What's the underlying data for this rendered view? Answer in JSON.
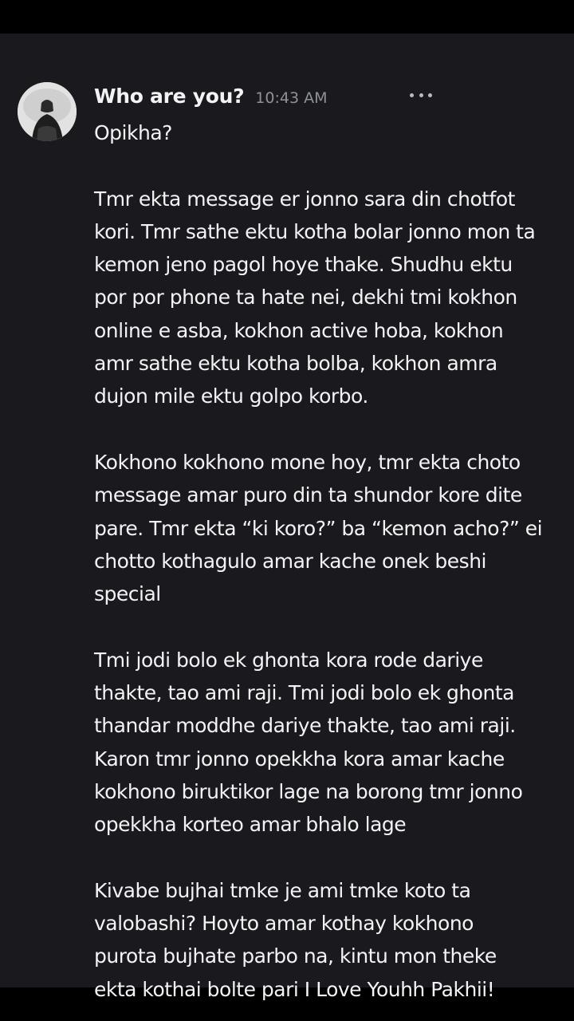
{
  "message": {
    "author": "Who are you?",
    "time": "10:43 AM",
    "greeting": "Opikha?",
    "paragraphs": [
      "Tmr ekta message er jonno sara din chotfot\nkori. Tmr sathe ektu kotha bolar jonno mon ta\nkemon jeno pagol hoye thake. Shudhu ektu\npor por phone ta hate nei, dekhi tmi kokhon\nonline e asba, kokhon active hoba, kokhon\namr sathe ektu kotha bolba, kokhon amra\ndujon mile ektu golpo korbo.",
      "Kokhono kokhono mone hoy, tmr ekta choto\nmessage amar puro din ta shundor kore dite\npare. Tmr ekta “ki koro?” ba “kemon acho?” ei\nchotto kothagulo amar kache onek beshi\nspecial",
      "Tmi jodi bolo ek ghonta kora rode dariye\nthakte, tao ami raji. Tmi jodi bolo ek ghonta\nthandar moddhe dariye thakte, tao ami raji.\nKaron tmr jonno opekkha kora amar kache\nkokhono biruktikor lage na borong tmr jonno\nopekkha korteo amar bhalo lage",
      "Kivabe bujhai tmke je ami tmke koto ta\nvalobashi? Hoyto amar kothay kokhono\npurota bujhate parbo na, kintu mon theke\nekta kothai bolte pari I Love Youhh Pakhii!"
    ]
  },
  "icons": {
    "avatar": "user-avatar-photo",
    "more": "more-options-icon"
  },
  "colors": {
    "background": "#1a1a1e",
    "text": "#f2f3f5",
    "timestamp": "#8e9297"
  }
}
